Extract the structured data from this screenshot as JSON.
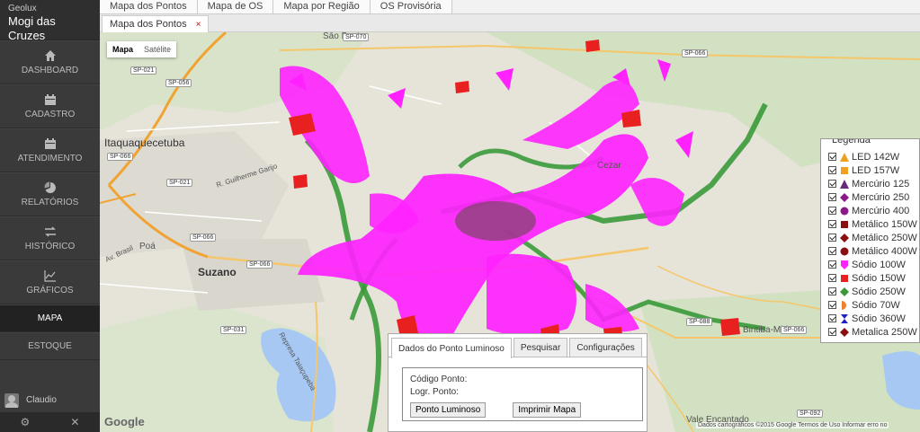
{
  "app": {
    "brand_small": "Geolux",
    "brand_big": "Mogi das Cruzes"
  },
  "sidebar": {
    "items": [
      {
        "label": "DASHBOARD",
        "icon": "home-icon"
      },
      {
        "label": "CADASTRO",
        "icon": "calendar-icon"
      },
      {
        "label": "ATENDIMENTO",
        "icon": "calendar-icon"
      },
      {
        "label": "RELATÓRIOS",
        "icon": "pie-chart-icon"
      },
      {
        "label": "HISTÓRICO",
        "icon": "swap-arrows-icon"
      },
      {
        "label": "GRÁFICOS",
        "icon": "line-chart-icon"
      },
      {
        "label": "MAPA",
        "icon": "",
        "active": true
      },
      {
        "label": "ESTOQUE",
        "icon": ""
      }
    ],
    "user": "Claudio"
  },
  "top_tabs": [
    "Mapa dos Pontos",
    "Mapa de OS",
    "Mapa por Região",
    "OS Provisória"
  ],
  "open_tab": {
    "label": "Mapa dos Pontos",
    "close": "×"
  },
  "map": {
    "type_buttons": {
      "map": "Mapa",
      "satellite": "Satélite"
    },
    "labels": {
      "sao_bento": "São Bento",
      "itaquaquecetuba": "Itaquaquecetuba",
      "suzano": "Suzano",
      "poa": "Poá",
      "cezar": "Cezar",
      "biritiba": "Biritiba-Mirim",
      "vale": "Vale Encantado",
      "avenida": "R. Guilherme Garijo",
      "represa": "Represa Taiaçupeba",
      "av_brasil": "Av. Brasil"
    },
    "roads": {
      "sp070": "SP-070",
      "sp021a": "SP-021",
      "sp056": "SP-056",
      "sp066a": "SP-066",
      "sp066b": "SP-066",
      "sp021b": "SP-021",
      "sp066c": "SP-066",
      "sp066d": "SP-066",
      "sp031": "SP-031",
      "sp088": "SP-088",
      "sp092": "SP-092",
      "sp066e": "SP-066"
    },
    "google": "Google",
    "footer": "Dados cartográficos ©2015 Google   Termos de Uso   Informar erro no"
  },
  "legend": {
    "title": "Legenda",
    "items": [
      {
        "label": "LED 142W",
        "color": "#f0a020",
        "shape": "triangle"
      },
      {
        "label": "LED 157W",
        "color": "#f0a020",
        "shape": "square"
      },
      {
        "label": "Mercúrio 125",
        "color": "#6a2a7a",
        "shape": "triangle"
      },
      {
        "label": "Mercúrio 250",
        "color": "#8a1a8a",
        "shape": "diamond"
      },
      {
        "label": "Mercúrio 400",
        "color": "#8a1a8a",
        "shape": "circle"
      },
      {
        "label": "Metálico 150W",
        "color": "#8a1010",
        "shape": "square"
      },
      {
        "label": "Metálico 250W",
        "color": "#8a1010",
        "shape": "diamond"
      },
      {
        "label": "Metálico 400W",
        "color": "#8a1010",
        "shape": "circle"
      },
      {
        "label": "Sódio 100W",
        "color": "#ff22ff",
        "shape": "shield"
      },
      {
        "label": "Sódio 150W",
        "color": "#e82020",
        "shape": "square"
      },
      {
        "label": "Sódio 250W",
        "color": "#3a9a3a",
        "shape": "diamond"
      },
      {
        "label": "Sódio 70W",
        "color": "#f08030",
        "shape": "half"
      },
      {
        "label": "Sódio 360W",
        "color": "#2020c0",
        "shape": "hourglass"
      },
      {
        "label": "Metalica 250W",
        "color": "#8a1010",
        "shape": "diamond"
      }
    ]
  },
  "panel": {
    "tabs": [
      "Dados do Ponto Luminoso",
      "Pesquisar",
      "Configurações"
    ],
    "codigo": "Código Ponto:",
    "logr": "Logr. Ponto:",
    "btn_ponto": "Ponto Luminoso",
    "btn_imprimir": "Imprimir Mapa"
  }
}
